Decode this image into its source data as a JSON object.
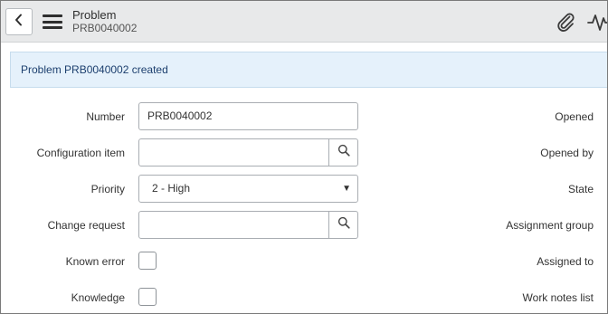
{
  "header": {
    "title": "Problem",
    "subtitle": "PRB0040002",
    "icons": [
      "back-icon",
      "menu-icon",
      "paperclip-icon",
      "activity-icon"
    ]
  },
  "banner": {
    "message": "Problem PRB0040002 created"
  },
  "form": {
    "number": {
      "label": "Number",
      "value": "PRB0040002"
    },
    "configuration_item": {
      "label": "Configuration item",
      "value": ""
    },
    "priority": {
      "label": "Priority",
      "value": "2 - High"
    },
    "change_request": {
      "label": "Change request",
      "value": ""
    },
    "known_error": {
      "label": "Known error",
      "checked": false
    },
    "knowledge": {
      "label": "Knowledge",
      "checked": false
    }
  },
  "right_column": {
    "opened": "Opened",
    "opened_by": "Opened by",
    "state": "State",
    "assignment_group": "Assignment group",
    "assigned_to": "Assigned to",
    "work_notes_list": "Work notes list"
  },
  "colors": {
    "header_bg": "#e8e9ea",
    "banner_bg": "#e5f1fb",
    "banner_text": "#1c3f6e",
    "field_border": "#a9adb2"
  }
}
